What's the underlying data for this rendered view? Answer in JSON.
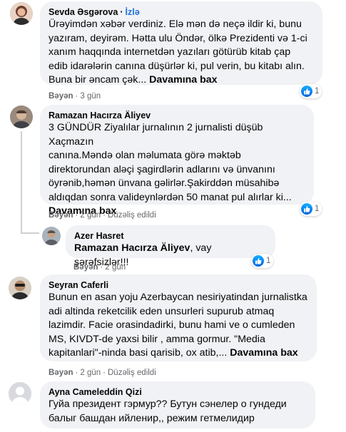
{
  "comments": [
    {
      "author": "Sevda Əsgərova",
      "follow": "İzlə",
      "text": "Ürəyimdən xəbər verdiniz. Elə mən də neçə ildir ki, bunu\nyazıram, deyirəm. Hətta ulu Öndər, ölkə Prezidenti və 1-ci\nxanım haqqında internetdən yazıları götürüb kitab çap\nedib idarələrin canına düşürlər ki, pul verin, bu kitabı alın.\nBuna bir əncam çək... ",
      "more": "Davamına bax",
      "like": "Bəyən",
      "time": "3 gün",
      "reactions": "1",
      "avatar_color": "#b98a74"
    },
    {
      "author": "Ramazan Hacırza Äliyev",
      "text": "3 GÜNDÜR Ziyalılar jurnalının 2 jurnalisti düşüb Xaçmazın\ncanına.Məndə olan məlumata görə məktəb\ndirektorundan aləçi şagirdlərin adlarını və ünvanını\nöyrənib,həmən ünvana gəlirlər.Şakirddən müsahibə\naldıqdan sonra valideynlərdən 50 manat pul alırlar ki...\n",
      "more": "Davamına bax",
      "like": "Bəyən",
      "time": "2 gün",
      "edited": "Düzəliş edildi",
      "reactions": "1",
      "avatar_color": "#7b6a5e"
    },
    {
      "author": "Azer Hasret",
      "mention": "Ramazan Hacırza Äliyev",
      "text": ", vay şərəfsizlər!!!",
      "like": "Bəyən",
      "time": "2 gün",
      "reactions": "1",
      "avatar_color": "#8c8f96"
    },
    {
      "author": "Seyran Caferli",
      "text": "Bunun en asan yoju Azerbaycan nesiriyatindan jurnalistka\nadi altinda reketcilik eden unsurleri supurub atmaq\nlazimdir. Facie orasindadirki, bunu hami ve o cumleden\nMS, KIVDT-de yaxsi bilir , amma gormur. \"Media\nkapitanlari\"-ninda basi qarisib, ox atib,... ",
      "more": "Davamına bax",
      "like": "Bəyən",
      "time": "2 gün",
      "edited": "Düzəliş edildi",
      "avatar_color": "#3d3a36"
    },
    {
      "author": "Ayna Cameleddin Qizi",
      "text": "Гуйа президент гэрмур?? Бутун сэнелер о гундеди\nбалыг башдан ийленир,, режим гетмелидир",
      "avatar_color": "#d8dadf"
    }
  ],
  "colors": {
    "bubble": "#f0f2f5",
    "secondary_text": "#65676b",
    "like_blue": "#1877f2",
    "follow_blue": "#216fdb"
  }
}
